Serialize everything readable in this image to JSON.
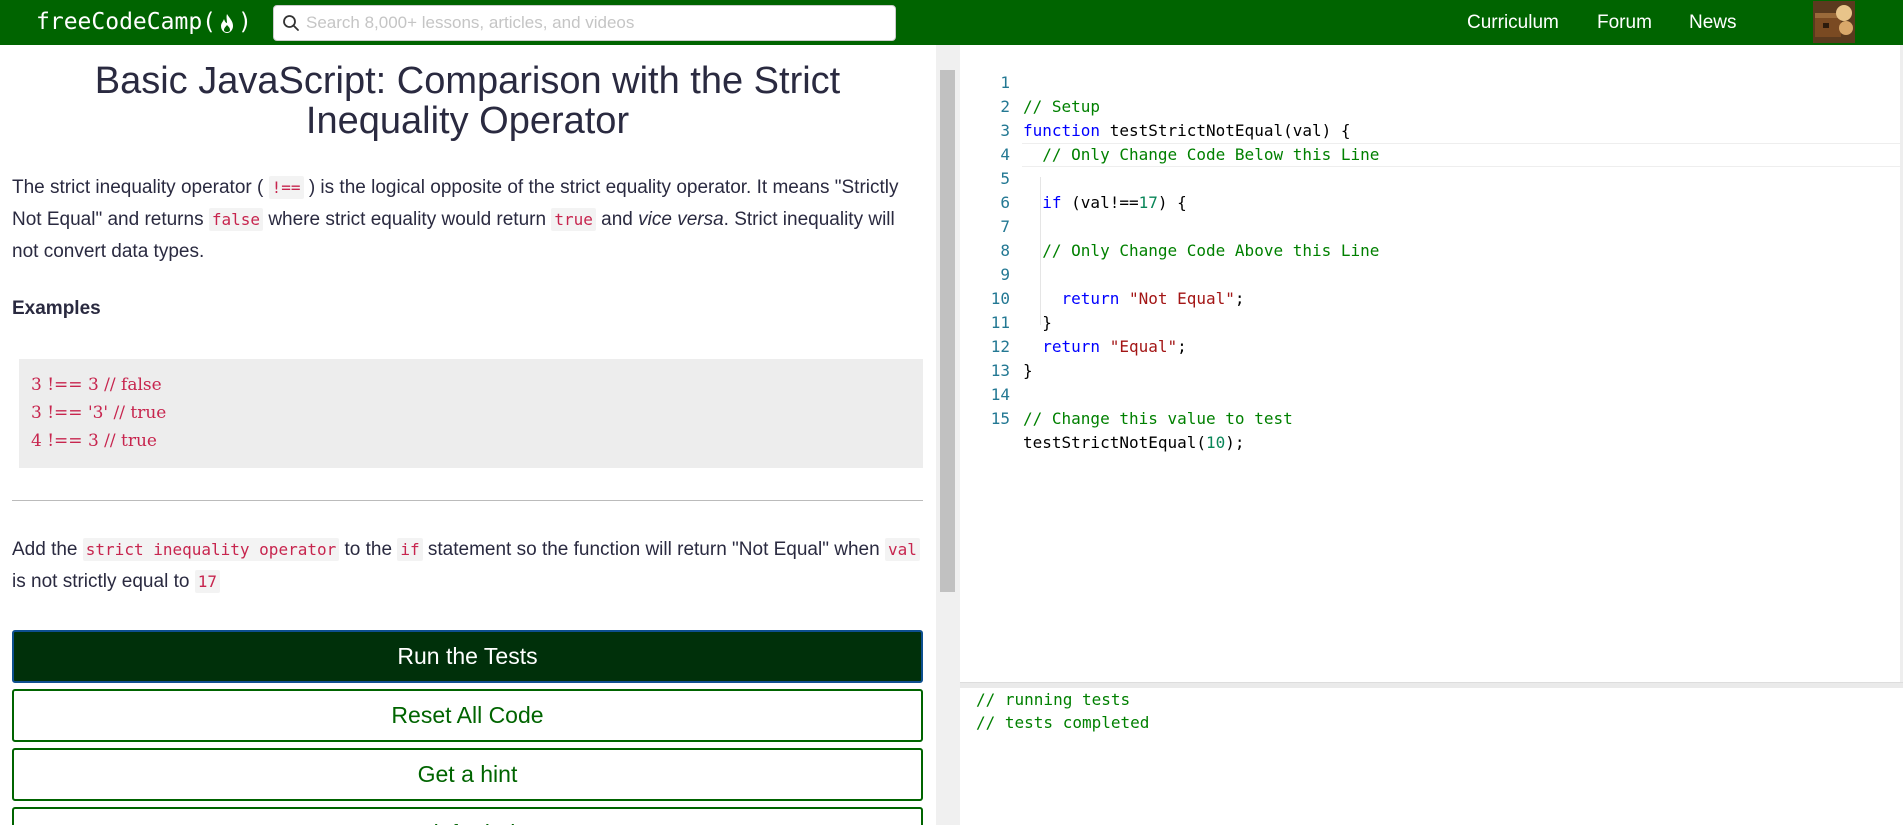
{
  "navbar": {
    "logo_text": "freeCodeCamp(",
    "logo_close": ")",
    "search_placeholder": "Search 8,000+ lessons, articles, and videos",
    "links": [
      "Curriculum",
      "Forum",
      "News"
    ]
  },
  "challenge": {
    "title": "Basic JavaScript: Comparison with the Strict Inequality Operator",
    "description": {
      "p1_a": "The strict inequality operator (",
      "p1_code1": "!==",
      "p1_b": ") is the logical opposite of the strict equality operator. It means \"Strictly Not Equal\" and returns",
      "p1_code2": "false",
      "p1_c": "where strict equality would return",
      "p1_code3": "true",
      "p1_d": "and",
      "p1_em": "vice versa",
      "p1_e": ". Strict inequality will not convert data types."
    },
    "examples_heading": "Examples",
    "examples": [
      "3 !== 3 // false",
      "3 !== '3' // true",
      "4 !== 3 // true"
    ],
    "instructions": {
      "a": "Add the",
      "code1": "strict inequality operator",
      "b": "to the",
      "code2": "if",
      "c": "statement so the function will return \"Not Equal\" when",
      "code3": "val",
      "d": "is not strictly equal to",
      "code4": "17"
    }
  },
  "buttons": {
    "run": "Run the Tests",
    "reset": "Reset All Code",
    "hint": "Get a hint",
    "help": "Ask for help"
  },
  "editor": {
    "lines": [
      {
        "n": "1"
      },
      {
        "n": "2"
      },
      {
        "n": "3"
      },
      {
        "n": "4"
      },
      {
        "n": "5"
      },
      {
        "n": "6"
      },
      {
        "n": "7"
      },
      {
        "n": "8"
      },
      {
        "n": "9"
      },
      {
        "n": "10"
      },
      {
        "n": "11"
      },
      {
        "n": "12"
      },
      {
        "n": "13"
      },
      {
        "n": "14"
      },
      {
        "n": "15"
      }
    ],
    "code": {
      "l1": "// Setup",
      "l2_kw": "function",
      "l2_rest": " testStrictNotEqual(val) {",
      "l3": "  // Only Change Code Below this Line",
      "l5_kw": "  if",
      "l5_a": " (val!==",
      "l5_num": "17",
      "l5_b": ") {",
      "l7": "  // Only Change Code Above this Line",
      "l9_kw": "    return",
      "l9_str": " \"Not Equal\"",
      "l9_end": ";",
      "l10": "  }",
      "l11_kw": "  return",
      "l11_str": " \"Equal\"",
      "l11_end": ";",
      "l12": "}",
      "l14": "// Change this value to test",
      "l15_a": "testStrictNotEqual(",
      "l15_num": "10",
      "l15_b": ");"
    }
  },
  "console": {
    "lines": [
      "// running tests",
      "// tests completed"
    ]
  },
  "colors": {
    "nav_bg": "#006400",
    "run_button_bg": "#00300a",
    "code_accent": "#c7254e"
  }
}
